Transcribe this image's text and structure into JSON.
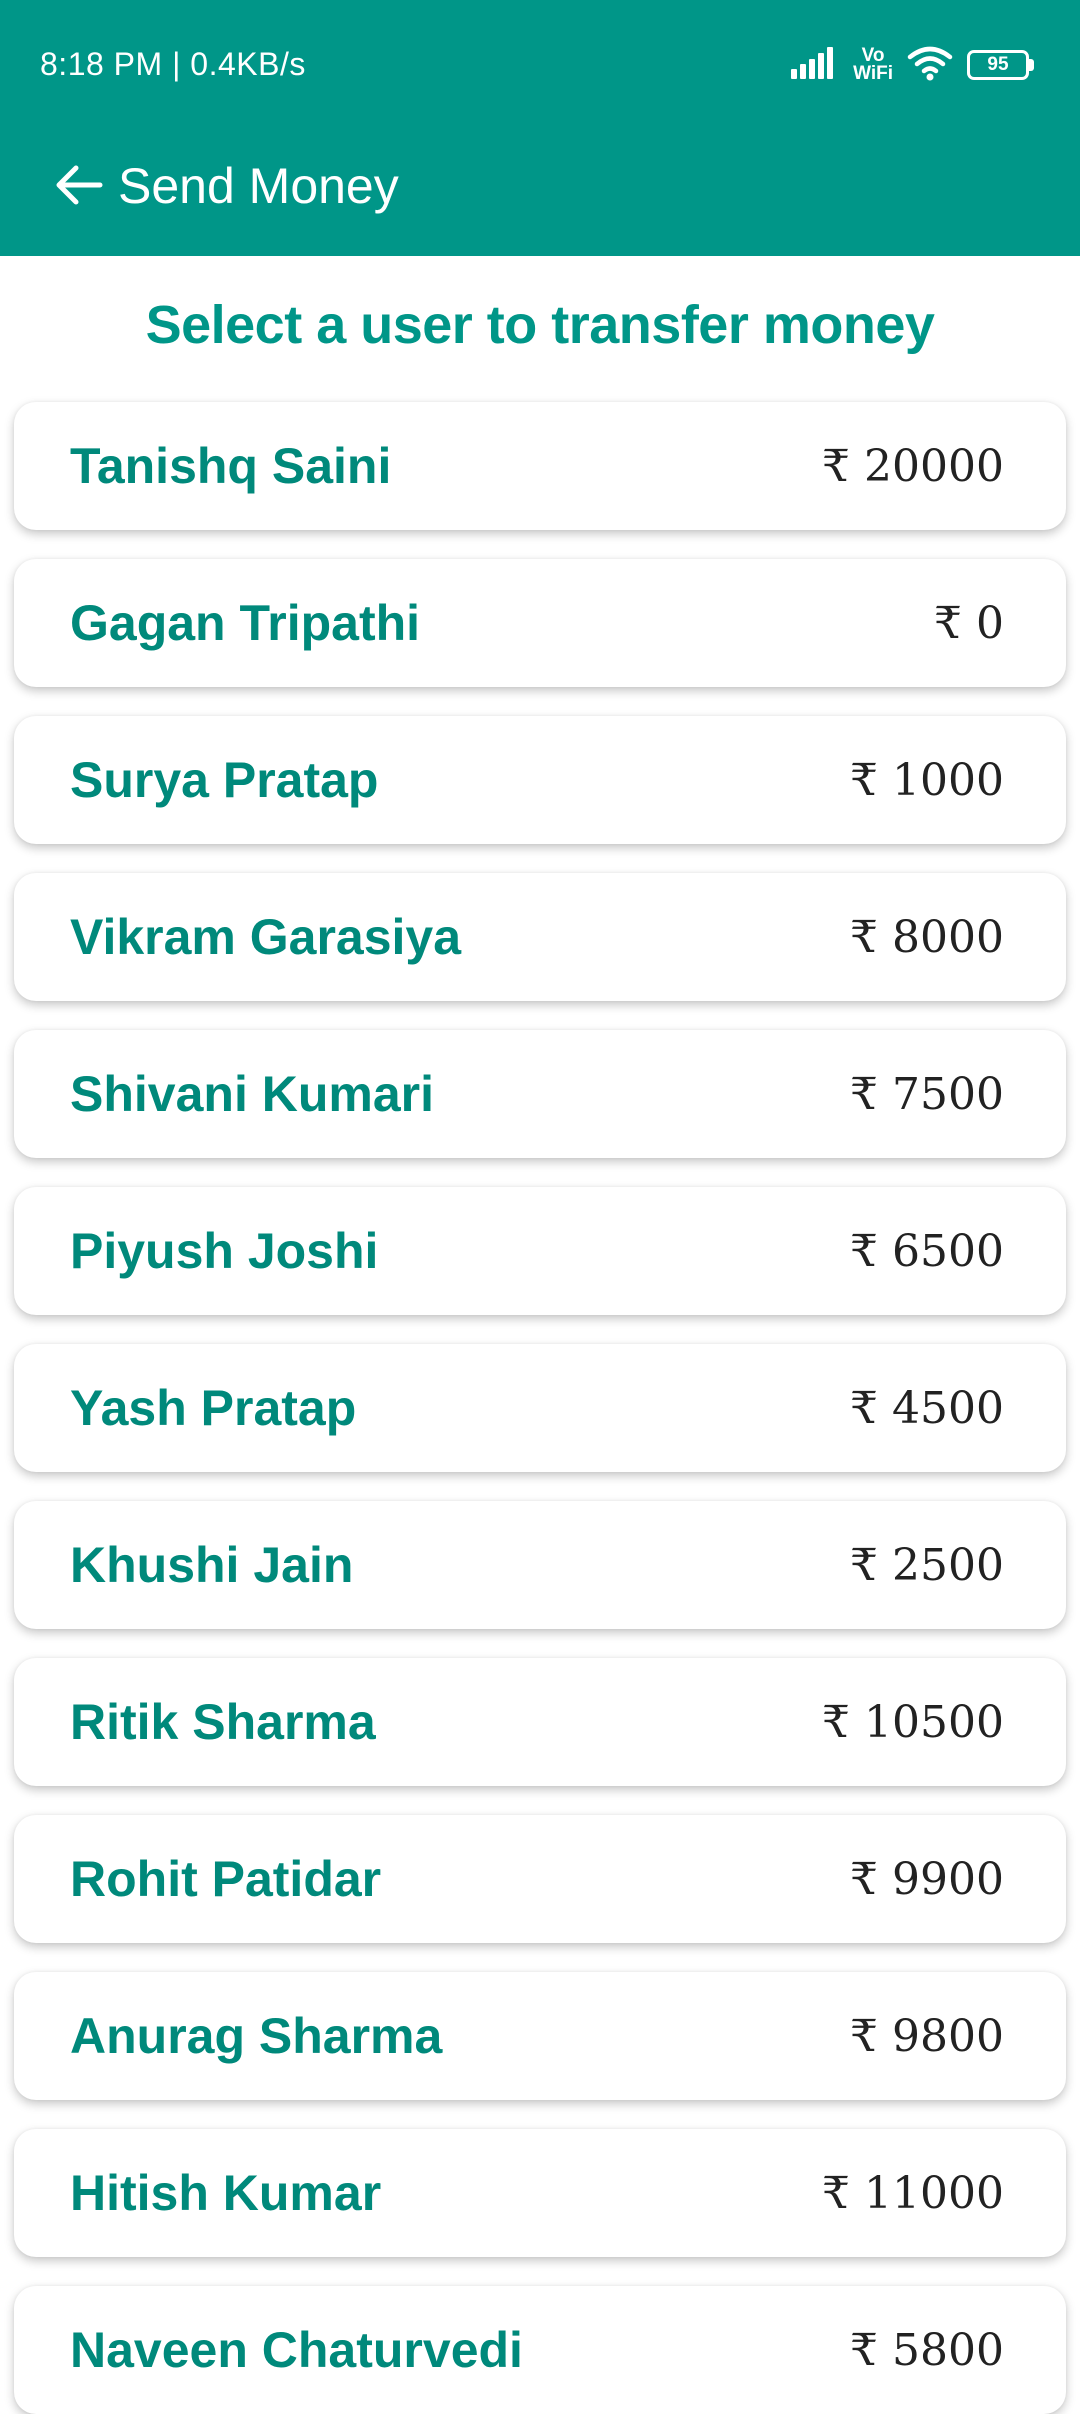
{
  "status_bar": {
    "time_speed": "8:18 PM | 0.4KB/s",
    "vowifi_top": "Vo",
    "vowifi_bottom": "WiFi",
    "battery_level": "95",
    "icons": [
      "signal-icon",
      "wifi-icon",
      "battery-icon"
    ]
  },
  "app_bar": {
    "title": "Send Money",
    "back_icon": "arrow-left-icon"
  },
  "heading": "Select a user to transfer money",
  "currency_symbol": "₹",
  "users": [
    {
      "name": "Tanishq Saini",
      "amount": "₹ 20000"
    },
    {
      "name": "Gagan Tripathi",
      "amount": "₹ 0"
    },
    {
      "name": "Surya Pratap",
      "amount": "₹ 1000"
    },
    {
      "name": "Vikram Garasiya",
      "amount": "₹ 8000"
    },
    {
      "name": "Shivani Kumari",
      "amount": "₹ 7500"
    },
    {
      "name": "Piyush Joshi",
      "amount": "₹ 6500"
    },
    {
      "name": "Yash Pratap",
      "amount": "₹ 4500"
    },
    {
      "name": "Khushi Jain",
      "amount": "₹ 2500"
    },
    {
      "name": "Ritik Sharma",
      "amount": "₹ 10500"
    },
    {
      "name": "Rohit Patidar",
      "amount": "₹ 9900"
    },
    {
      "name": "Anurag Sharma",
      "amount": "₹ 9800"
    },
    {
      "name": "Hitish Kumar",
      "amount": "₹ 11000"
    },
    {
      "name": "Naveen Chaturvedi",
      "amount": "₹ 5800"
    }
  ],
  "colors": {
    "primary": "#009688",
    "name_text": "#00897b",
    "amount_text": "#222222",
    "card_bg": "#ffffff"
  }
}
